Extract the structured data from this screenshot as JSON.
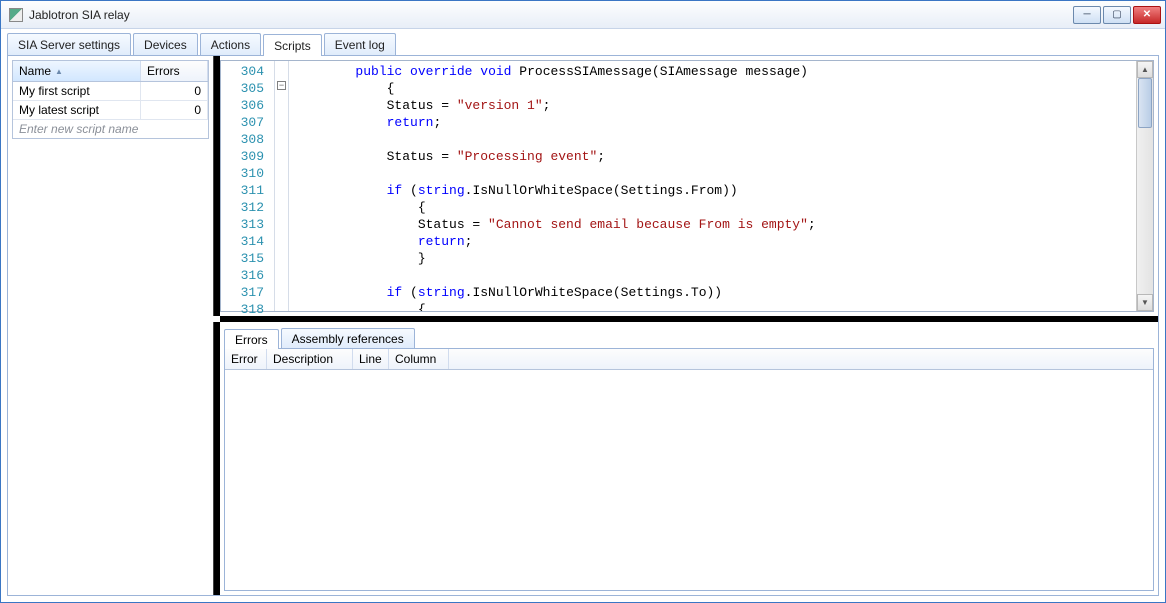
{
  "window": {
    "title": "Jablotron SIA relay"
  },
  "tabs": {
    "t0": "SIA Server settings",
    "t1": "Devices",
    "t2": "Actions",
    "t3": "Scripts",
    "t4": "Event log"
  },
  "scripts_table": {
    "cols": {
      "name": "Name",
      "errors": "Errors"
    },
    "rows": [
      {
        "name": "My first script",
        "errors": "0"
      },
      {
        "name": "My latest script",
        "errors": "0"
      }
    ],
    "new_placeholder": "Enter new script name"
  },
  "editor": {
    "first_line": 304,
    "lines": [
      {
        "segs": [
          {
            "t": "        "
          },
          {
            "t": "public",
            "c": "kw"
          },
          {
            "t": " "
          },
          {
            "t": "override",
            "c": "kw"
          },
          {
            "t": " "
          },
          {
            "t": "void",
            "c": "kw"
          },
          {
            "t": " ProcessSIAmessage(SIAmessage message)"
          }
        ]
      },
      {
        "segs": [
          {
            "t": "            {"
          }
        ]
      },
      {
        "segs": [
          {
            "t": "            Status = "
          },
          {
            "t": "\"version 1\"",
            "c": "str"
          },
          {
            "t": ";"
          }
        ]
      },
      {
        "segs": [
          {
            "t": "            "
          },
          {
            "t": "return",
            "c": "kw"
          },
          {
            "t": ";"
          }
        ]
      },
      {
        "segs": [
          {
            "t": ""
          }
        ]
      },
      {
        "segs": [
          {
            "t": "            Status = "
          },
          {
            "t": "\"Processing event\"",
            "c": "str"
          },
          {
            "t": ";"
          }
        ]
      },
      {
        "segs": [
          {
            "t": ""
          }
        ]
      },
      {
        "segs": [
          {
            "t": "            "
          },
          {
            "t": "if",
            "c": "kw"
          },
          {
            "t": " ("
          },
          {
            "t": "string",
            "c": "kw"
          },
          {
            "t": ".IsNullOrWhiteSpace(Settings.From))"
          }
        ]
      },
      {
        "segs": [
          {
            "t": "                {"
          }
        ]
      },
      {
        "segs": [
          {
            "t": "                Status = "
          },
          {
            "t": "\"Cannot send email because From is empty\"",
            "c": "str"
          },
          {
            "t": ";"
          }
        ]
      },
      {
        "segs": [
          {
            "t": "                "
          },
          {
            "t": "return",
            "c": "kw"
          },
          {
            "t": ";"
          }
        ]
      },
      {
        "segs": [
          {
            "t": "                }"
          }
        ]
      },
      {
        "segs": [
          {
            "t": ""
          }
        ]
      },
      {
        "segs": [
          {
            "t": "            "
          },
          {
            "t": "if",
            "c": "kw"
          },
          {
            "t": " ("
          },
          {
            "t": "string",
            "c": "kw"
          },
          {
            "t": ".IsNullOrWhiteSpace(Settings.To))"
          }
        ]
      },
      {
        "segs": [
          {
            "t": "                {"
          }
        ]
      }
    ]
  },
  "sub_tabs": {
    "errors": "Errors",
    "refs": "Assembly references"
  },
  "errors_panel": {
    "cols": {
      "error": "Error",
      "desc": "Description",
      "line": "Line",
      "col": "Column"
    }
  }
}
